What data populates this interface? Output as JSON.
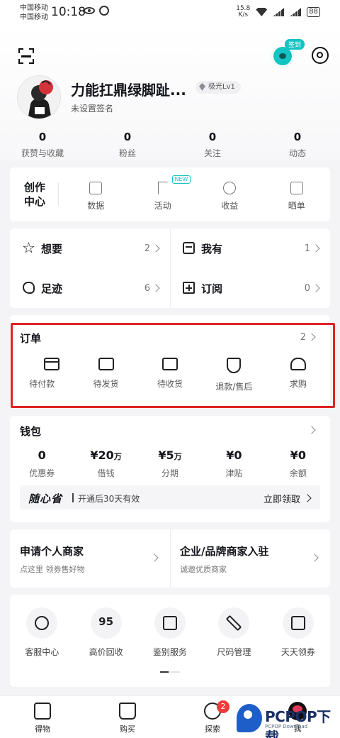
{
  "status_bar": {
    "carrier_1": "中国移动",
    "carrier_2": "中国移动",
    "time": "10:18",
    "net_speed_value": "15.8",
    "net_speed_unit": "K/s",
    "battery": "88"
  },
  "header": {
    "signin_badge": "签到",
    "username": "力能扛鼎绿脚趾...",
    "level": "极光Lv1",
    "signature": "未设置签名"
  },
  "stats": [
    {
      "value": "0",
      "label": "获赞与收藏"
    },
    {
      "value": "0",
      "label": "粉丝"
    },
    {
      "value": "0",
      "label": "关注"
    },
    {
      "value": "0",
      "label": "动态"
    }
  ],
  "creator": {
    "title": "创作中心",
    "new_tag": "NEW",
    "items": [
      {
        "label": "数据",
        "icon": "chart-icon"
      },
      {
        "label": "活动",
        "icon": "flag-icon"
      },
      {
        "label": "收益",
        "icon": "yuan-icon"
      },
      {
        "label": "晒单",
        "icon": "edit-icon"
      }
    ]
  },
  "wants": {
    "want": {
      "label": "想要",
      "count": "2"
    },
    "have": {
      "label": "我有",
      "count": "1"
    },
    "footprint": {
      "label": "足迹",
      "count": "6"
    },
    "subscribe": {
      "label": "订阅",
      "count": "0"
    }
  },
  "orders": {
    "title": "订单",
    "count": "2",
    "items": [
      {
        "label": "待付款",
        "icon": "card-icon"
      },
      {
        "label": "待发货",
        "icon": "package-icon"
      },
      {
        "label": "待收货",
        "icon": "truck-icon"
      },
      {
        "label": "退款/售后",
        "icon": "shield-yuan-icon"
      },
      {
        "label": "求购",
        "icon": "heart-plus-icon"
      }
    ]
  },
  "wallet": {
    "title": "钱包",
    "items": [
      {
        "value": "0",
        "unit": "",
        "label": "优惠券"
      },
      {
        "value": "¥20",
        "unit": "万",
        "label": "借钱"
      },
      {
        "value": "¥5",
        "unit": "万",
        "label": "分期"
      },
      {
        "value": "¥0",
        "unit": "",
        "label": "津贴"
      },
      {
        "value": "¥0",
        "unit": "",
        "label": "余额"
      }
    ],
    "promo": {
      "brand": "随心省",
      "text": "开通后30天有效",
      "cta": "立即领取"
    }
  },
  "merchant": {
    "personal": {
      "title": "申请个人商家",
      "subtitle": "点这里 领券售好物"
    },
    "brand": {
      "title": "企业/品牌商家入驻",
      "subtitle": "诚邀优质商家"
    }
  },
  "services": [
    {
      "label": "客服中心",
      "icon": "headset-icon"
    },
    {
      "label": "高价回收",
      "icon": "recycle-95-icon",
      "glyph": "95"
    },
    {
      "label": "鉴别服务",
      "icon": "stamp-icon"
    },
    {
      "label": "尺码管理",
      "icon": "ruler-icon"
    },
    {
      "label": "天天领券",
      "icon": "coupon-icon"
    }
  ],
  "tabbar": {
    "items": [
      {
        "label": "得物",
        "icon": "dewu-icon"
      },
      {
        "label": "购买",
        "icon": "shopping-bag-icon"
      },
      {
        "label": "探索",
        "icon": "planet-icon"
      },
      {
        "label": "我",
        "icon": "user-avatar-icon"
      }
    ],
    "explore_badge": "2"
  },
  "watermark": {
    "text": "PCPOP下载",
    "subtitle": "PCPOP Download"
  },
  "colors": {
    "accent": "#13c4c4",
    "highlight_frame": "#e02424",
    "badge_red": "#f23a3a"
  }
}
